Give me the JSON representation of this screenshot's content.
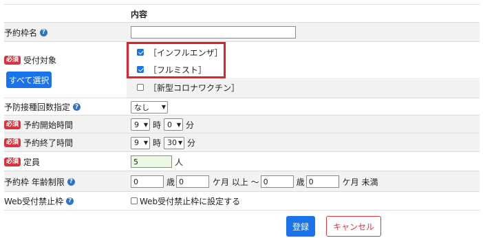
{
  "header": {
    "column_title": "内容"
  },
  "fields": {
    "reservation_name": {
      "label": "予約枠名",
      "value": ""
    },
    "target": {
      "required": "必須",
      "label": "受付対象",
      "select_all_label": "すべて選択",
      "options": [
        {
          "label": "［インフルエンザ］",
          "checked": true
        },
        {
          "label": "［フルミスト］",
          "checked": true
        },
        {
          "label": "［新型コロナワクチン］",
          "checked": false
        }
      ]
    },
    "dose_limit": {
      "label": "予防接種回数指定",
      "selected": "なし"
    },
    "start_time": {
      "required": "必須",
      "label": "予約開始時間",
      "hour": "9",
      "hour_unit": "時",
      "minute": "0",
      "minute_unit": "分"
    },
    "end_time": {
      "required": "必須",
      "label": "予約終了時間",
      "hour": "9",
      "hour_unit": "時",
      "minute": "30",
      "minute_unit": "分"
    },
    "capacity": {
      "required": "必須",
      "label": "定員",
      "value": "5",
      "unit": "人"
    },
    "age_limit": {
      "label": "予約枠 年齢制限",
      "from_years": "0",
      "years_unit": "歳",
      "from_months": "0",
      "months_unit_from": "ケ月 以上 〜",
      "to_years": "0",
      "years_unit_to": "歳",
      "to_months": "0",
      "months_unit_to": "ケ月 未満"
    },
    "web_block": {
      "label": "Web受付禁止枠",
      "checkbox_label": "Web受付禁止枠に設定する",
      "checked": false
    }
  },
  "actions": {
    "register_label": "登録",
    "cancel_label": "キャンセル"
  },
  "help_icon_glyph": "?",
  "colors": {
    "primary": "#1a73e8",
    "required_badge": "#d9333f",
    "highlight": "#e0202a",
    "row_alt": "#f2f2f2"
  }
}
